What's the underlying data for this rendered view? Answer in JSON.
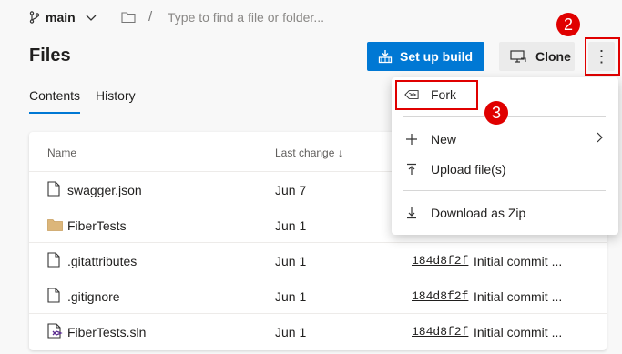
{
  "header": {
    "branch": "main",
    "path_placeholder": "Type to find a file or folder...",
    "separator": "/"
  },
  "page": {
    "title": "Files",
    "setup_build_label": "Set up build",
    "clone_label": "Clone",
    "more_label": "⋮"
  },
  "tabs": [
    {
      "label": "Contents",
      "active": true
    },
    {
      "label": "History",
      "active": false
    }
  ],
  "table": {
    "columns": {
      "name": "Name",
      "last_change": "Last change ↓"
    },
    "rows": [
      {
        "name": "swagger.json",
        "icon": "file-icon",
        "date": "Jun 7",
        "commit": "",
        "message": ""
      },
      {
        "name": "FiberTests",
        "icon": "folder-icon",
        "date": "Jun 1",
        "commit": "",
        "message": ""
      },
      {
        "name": ".gitattributes",
        "icon": "file-icon",
        "date": "Jun 1",
        "commit": "184d8f2f",
        "message": "Initial commit ..."
      },
      {
        "name": ".gitignore",
        "icon": "file-icon",
        "date": "Jun 1",
        "commit": "184d8f2f",
        "message": "Initial commit ..."
      },
      {
        "name": "FiberTests.sln",
        "icon": "solution-file-icon",
        "date": "Jun 1",
        "commit": "184d8f2f",
        "message": "Initial commit ..."
      }
    ]
  },
  "menu": {
    "fork": "Fork",
    "new": "New",
    "upload": "Upload file(s)",
    "download": "Download as Zip"
  },
  "annotations": {
    "step_more": "2",
    "step_fork": "3"
  },
  "colors": {
    "primary": "#0078d4",
    "highlight": "#e00000"
  }
}
